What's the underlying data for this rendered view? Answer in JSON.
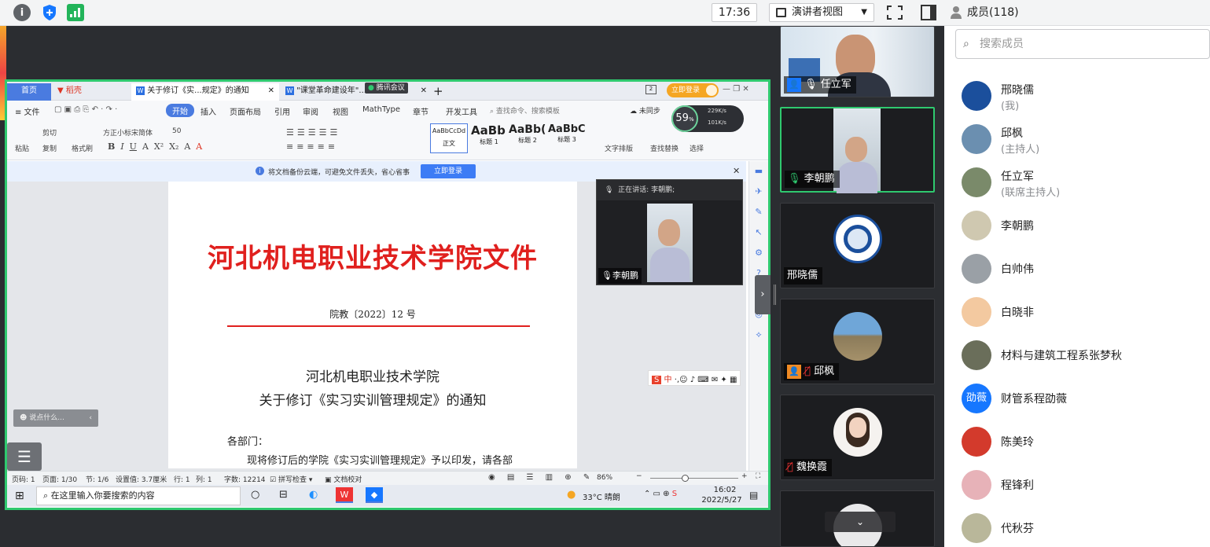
{
  "topbar": {
    "info_icon": "info-icon",
    "shield_icon": "shield-icon",
    "signal_icon": "signal-icon",
    "clock": "17:36",
    "presenter_view": "演讲者视图",
    "members_title": "成员(118)"
  },
  "wps": {
    "tabs": [
      {
        "label": "首页"
      },
      {
        "label": "稻壳"
      },
      {
        "label": "关于修订《实...规定》的通知"
      },
      {
        "label": "\"课堂革命建设年\"..."
      }
    ],
    "tencent_tag": "腾讯会议",
    "login_button": "立即登录",
    "menu": [
      "≡ 文件",
      "开始",
      "插入",
      "页面布局",
      "引用",
      "审阅",
      "视图",
      "MathType",
      "章节",
      "开发工具",
      "查找命令、搜索模板",
      "未同步"
    ],
    "toolbar_small": [
      "剪切",
      "复制",
      "粘贴",
      "格式刷",
      "方正小标宋简体",
      "50",
      "文字排版",
      "查找替换",
      "选择"
    ],
    "styles": [
      {
        "sample": "AaBbCcDd",
        "name": "正文"
      },
      {
        "sample": "AaBb",
        "name": "标题 1"
      },
      {
        "sample": "AaBb(",
        "name": "标题 2"
      },
      {
        "sample": "AaBbC",
        "name": "标题 3"
      }
    ],
    "net_percent": "59",
    "net_unit": "%",
    "net_up": "229K/s",
    "net_down": "101K/s",
    "notice_text": "将文档备份云端，可避免文件丢失，省心省事",
    "notice_button": "立即登录",
    "doc": {
      "header_title": "河北机电职业技术学院文件",
      "doc_number": "院教〔2022〕12 号",
      "title_line1": "河北机电职业技术学院",
      "title_line2": "关于修订《实习实训管理规定》的通知",
      "salutation": "各部门：",
      "body_line": "现将修订后的学院《实习实训管理规定》予以印发，请各部"
    },
    "chat_placeholder": "说点什么...",
    "status": [
      "页码: 1",
      "页面: 1/30",
      "节: 1/6",
      "设置值: 3.7厘米",
      "行: 1",
      "列: 1",
      "字数: 12214",
      "拼写检查",
      "文档校对"
    ],
    "zoom": "86%",
    "taskbar": {
      "search_placeholder": "在这里输入你要搜索的内容",
      "weather": "33°C 晴朗",
      "time": "16:02",
      "date": "2022/5/27"
    }
  },
  "float_video": {
    "speaking": "正在讲话: 李朝鹏;",
    "name": "李朝鹏"
  },
  "video_tiles": [
    {
      "name": "任立军",
      "kind": "camera"
    },
    {
      "name": "李朝鹏",
      "kind": "camera"
    },
    {
      "name": "邢晓儒",
      "kind": "logo"
    },
    {
      "name": "邱枫",
      "kind": "avatar"
    },
    {
      "name": "魏换霞",
      "kind": "avatar"
    },
    {
      "name": "",
      "kind": "avatar"
    }
  ],
  "members": {
    "search_placeholder": "搜索成员",
    "list": [
      {
        "name": "邢晓儒",
        "sub": "(我)",
        "color": "#1b4f9c"
      },
      {
        "name": "邱枫",
        "sub": "(主持人)",
        "color": "#6b8fb0"
      },
      {
        "name": "任立军",
        "sub": "(联席主持人)",
        "color": "#7a8a6a"
      },
      {
        "name": "李朝鹏",
        "sub": "",
        "color": "#cfc8b0"
      },
      {
        "name": "白帅伟",
        "sub": "",
        "color": "#9aa0a6"
      },
      {
        "name": "白晓非",
        "sub": "",
        "color": "#f3c9a0"
      },
      {
        "name": "材料与建筑工程系张梦秋",
        "sub": "",
        "color": "#6a6e5a"
      },
      {
        "name": "财管系程劭薇",
        "sub": "",
        "color": "#1677ff",
        "initials": "劭薇"
      },
      {
        "name": "陈美玲",
        "sub": "",
        "color": "#d33a2c"
      },
      {
        "name": "程锋利",
        "sub": "",
        "color": "#e7b2b8"
      },
      {
        "name": "代秋芬",
        "sub": "",
        "color": "#b9b79a"
      }
    ]
  }
}
